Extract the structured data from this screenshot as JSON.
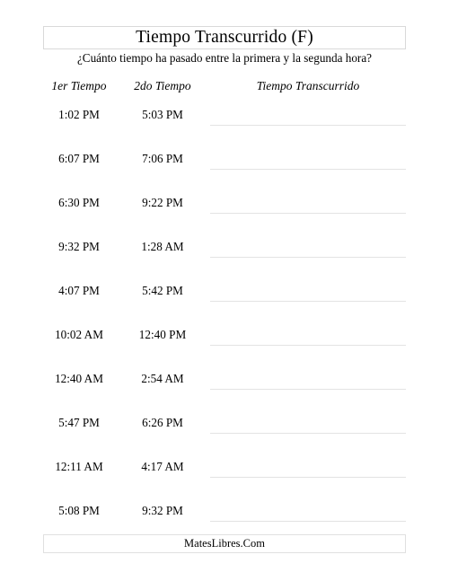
{
  "worksheet": {
    "title": "Tiempo Transcurrido (F)",
    "subtitle": "¿Cuánto tiempo ha pasado entre la primera y la segunda hora?",
    "footer": "MatesLibres.Com",
    "columns": {
      "first_time": "1er Tiempo",
      "second_time": "2do Tiempo",
      "elapsed_time": "Tiempo Transcurrido"
    },
    "rows": [
      {
        "first": "1:02 PM",
        "second": "5:03 PM",
        "elapsed": ""
      },
      {
        "first": "6:07 PM",
        "second": "7:06 PM",
        "elapsed": ""
      },
      {
        "first": "6:30 PM",
        "second": "9:22 PM",
        "elapsed": ""
      },
      {
        "first": "9:32 PM",
        "second": "1:28 AM",
        "elapsed": ""
      },
      {
        "first": "4:07 PM",
        "second": "5:42 PM",
        "elapsed": ""
      },
      {
        "first": "10:02 AM",
        "second": "12:40 PM",
        "elapsed": ""
      },
      {
        "first": "12:40 AM",
        "second": "2:54 AM",
        "elapsed": ""
      },
      {
        "first": "5:47 PM",
        "second": "6:26 PM",
        "elapsed": ""
      },
      {
        "first": "12:11 AM",
        "second": "4:17 AM",
        "elapsed": ""
      },
      {
        "first": "5:08 PM",
        "second": "9:32 PM",
        "elapsed": ""
      }
    ]
  }
}
